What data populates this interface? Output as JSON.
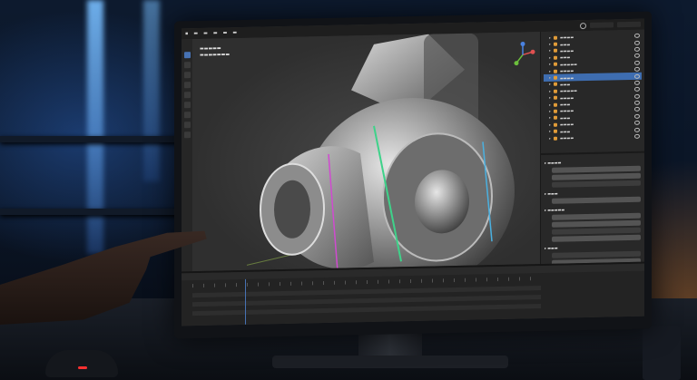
{
  "colors": {
    "accent_blue": "#4772b3",
    "selected_row": "#3e6db0",
    "object_orange": "#e09b38",
    "viewport_gray": "#3a3a3a"
  },
  "icons": [
    "search-icon",
    "eye-icon",
    "object-icon",
    "axis-gizmo-icon"
  ],
  "outliner_rows": 16,
  "selected_outliner_row": 6
}
